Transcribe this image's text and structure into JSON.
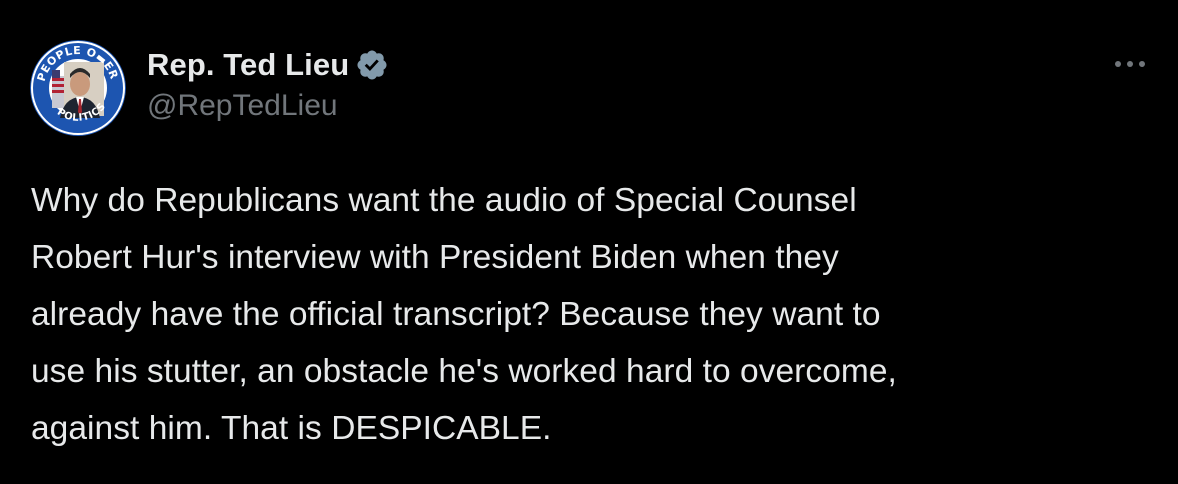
{
  "author": {
    "display_name": "Rep. Ted Lieu",
    "handle": "@RepTedLieu",
    "verified": true,
    "avatar_badge_text_top": "PEOPLE O",
    "avatar_badge_text_top2": "ER",
    "avatar_badge_text_bottom": "POLITICS"
  },
  "tweet": {
    "lines": [
      "Why do Republicans want the audio of Special Counsel",
      "Robert Hur's interview with President Biden when they",
      "already have the official transcript? Because they want to",
      "use his stutter, an obstacle he's worked hard to overcome,",
      "against him. That is DESPICABLE."
    ]
  },
  "icons": {
    "verified": "verified-badge-icon",
    "more": "more-options-icon"
  },
  "colors": {
    "background": "#000000",
    "text_primary": "#e7e9ea",
    "text_secondary": "#71767b",
    "verified_badge": "#829aab",
    "avatar_ring": "#1f5bb5"
  }
}
